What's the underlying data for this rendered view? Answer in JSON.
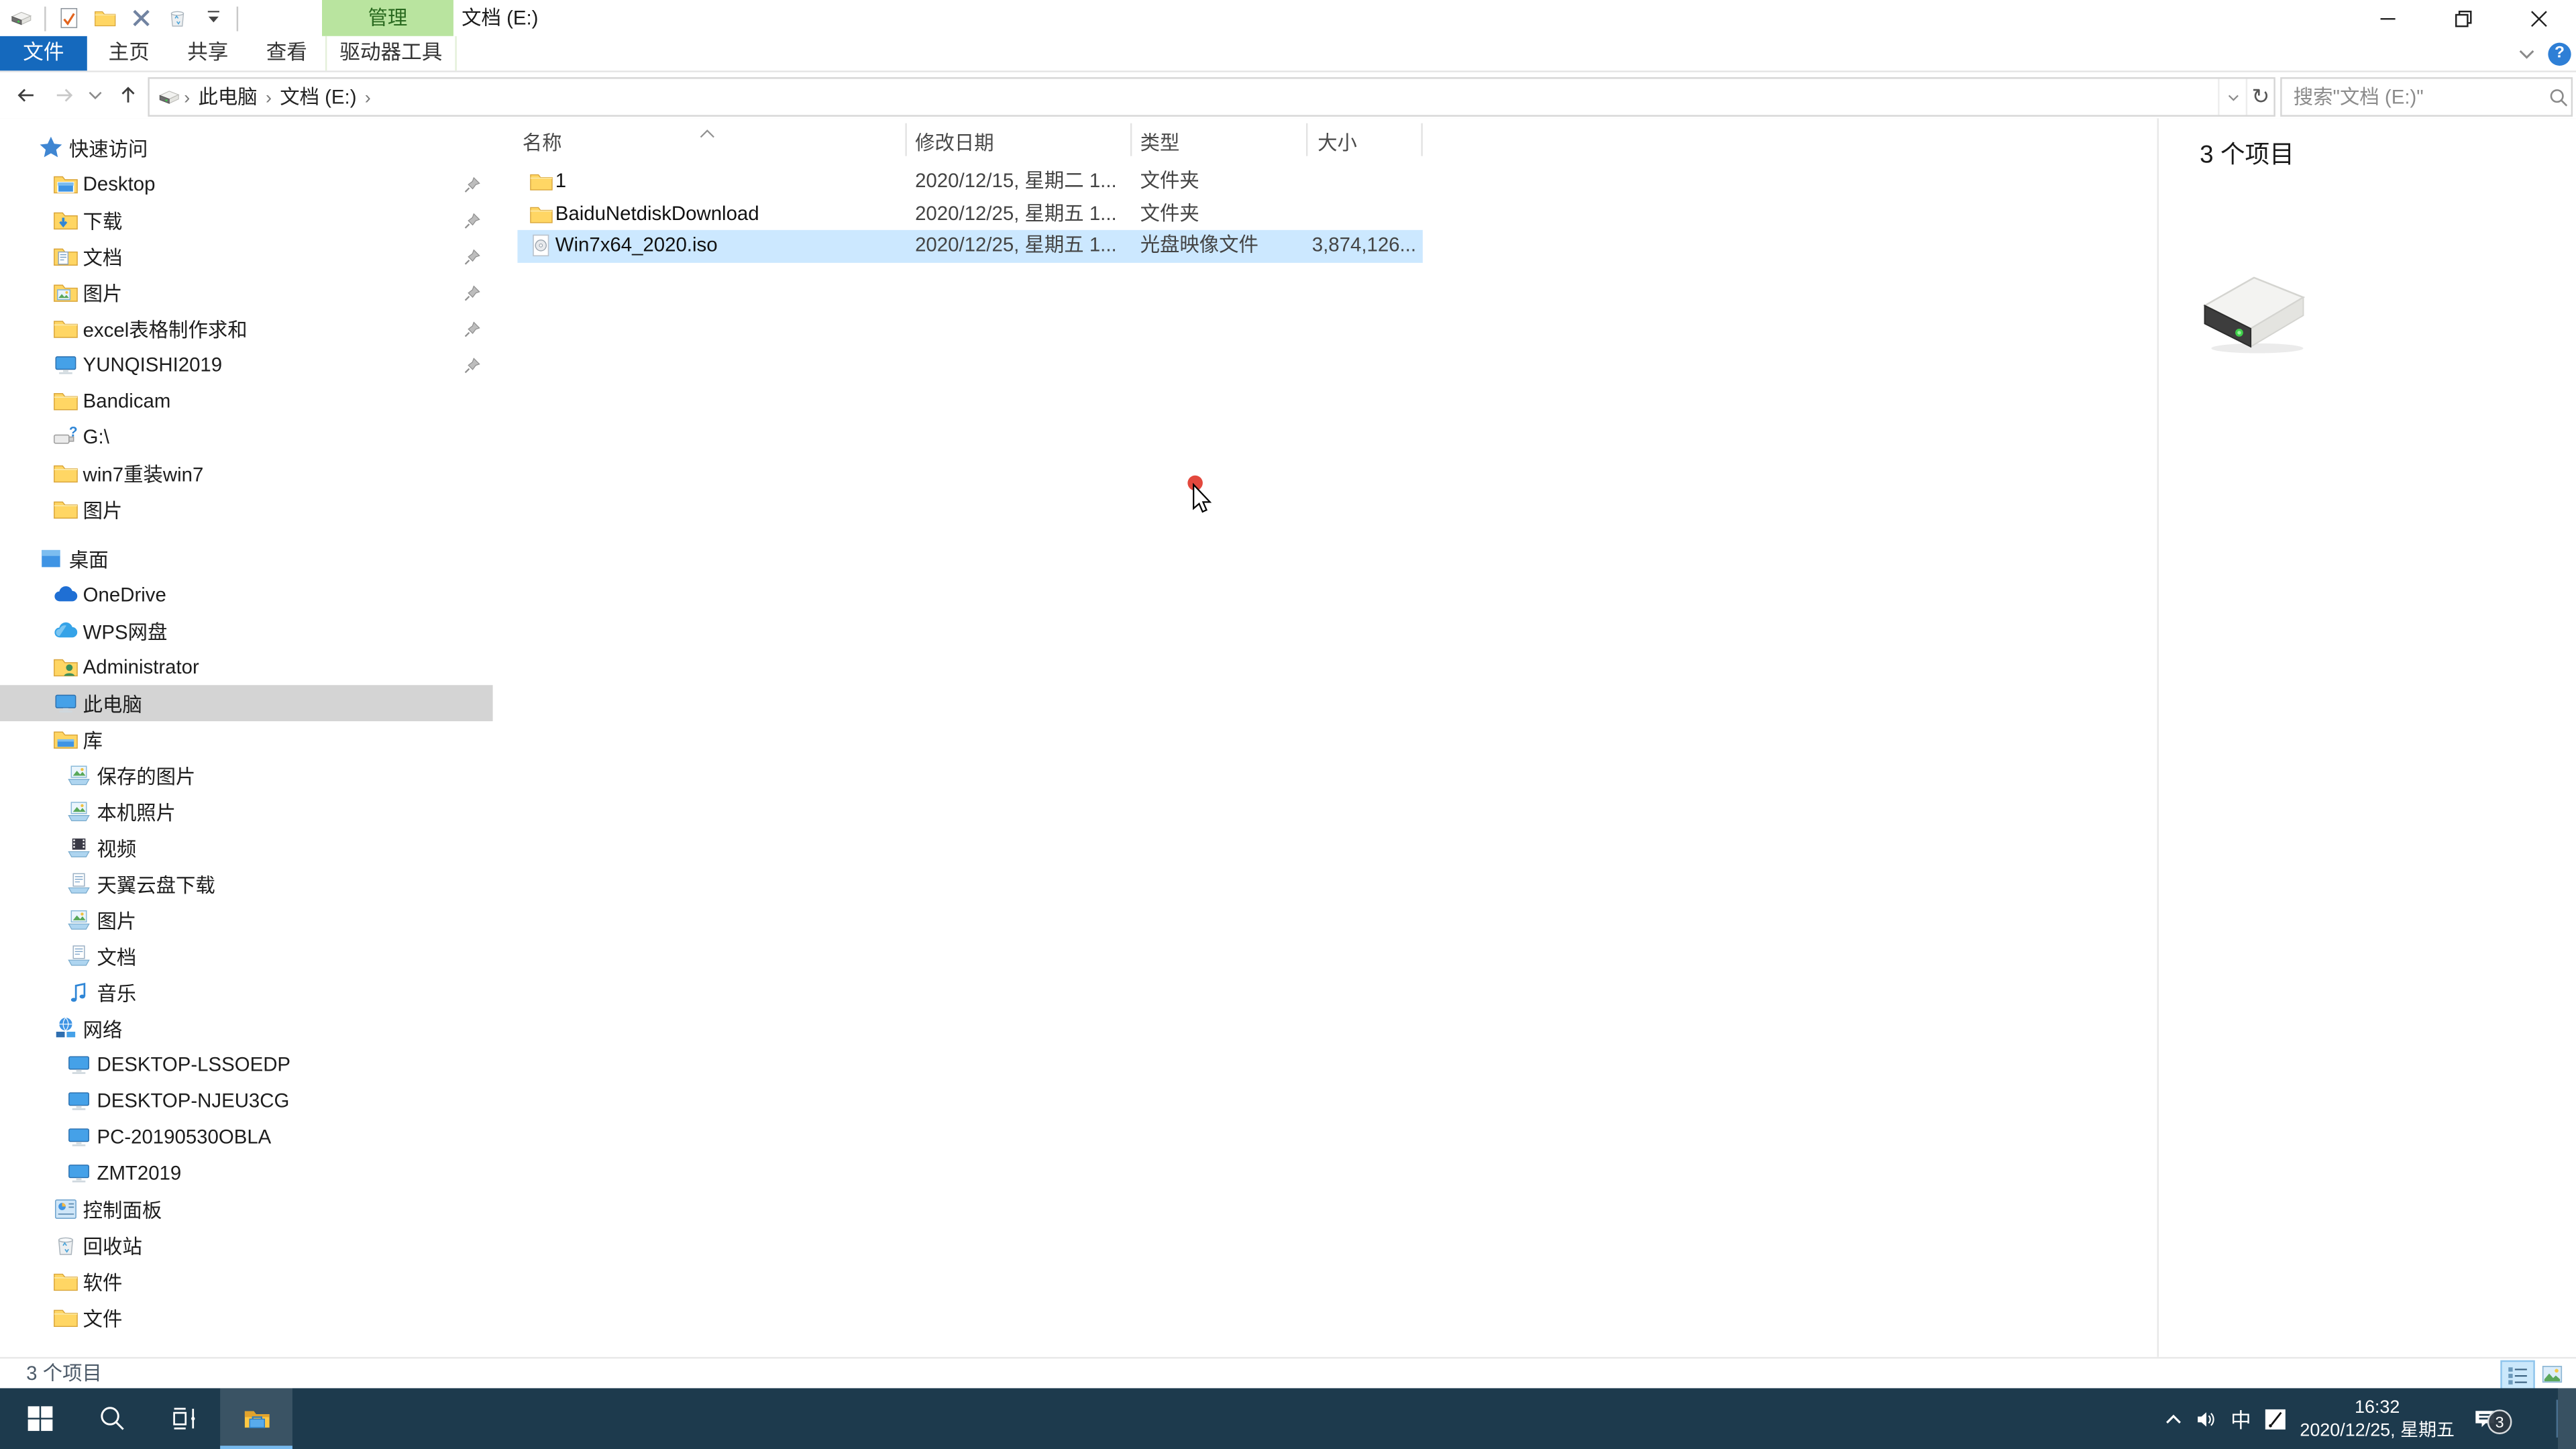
{
  "window": {
    "title": "文档 (E:)"
  },
  "qat": {
    "buttons": [
      "drive",
      "separator",
      "document-check",
      "folder",
      "delete-x",
      "recycle-bin",
      "dropdown",
      "separator"
    ]
  },
  "ribbon": {
    "contextual_group": "管理",
    "help_label": "?",
    "tabs": [
      {
        "label": "文件",
        "style": "file"
      },
      {
        "label": "主页"
      },
      {
        "label": "共享"
      },
      {
        "label": "查看"
      },
      {
        "label": "驱动器工具",
        "style": "contextual"
      }
    ]
  },
  "address": {
    "crumbs": [
      "此电脑",
      "文档 (E:)"
    ],
    "search_placeholder": "搜索\"文档 (E:)\""
  },
  "sidebar": {
    "items": [
      {
        "label": "快速访问",
        "icon": "quick-access-star",
        "level": 0
      },
      {
        "label": "Desktop",
        "icon": "folder-desktop",
        "level": 1,
        "pinned": true
      },
      {
        "label": "下载",
        "icon": "folder-download",
        "level": 1,
        "pinned": true
      },
      {
        "label": "文档",
        "icon": "folder-documents",
        "level": 1,
        "pinned": true
      },
      {
        "label": "图片",
        "icon": "folder-pictures",
        "level": 1,
        "pinned": true
      },
      {
        "label": "excel表格制作求和",
        "icon": "folder",
        "level": 1,
        "pinned": true
      },
      {
        "label": "YUNQISHI2019",
        "icon": "computer",
        "level": 1,
        "pinned": true
      },
      {
        "label": "Bandicam",
        "icon": "folder",
        "level": 1
      },
      {
        "label": "G:\\",
        "icon": "usb-drive",
        "level": 1
      },
      {
        "label": "win7重装win7",
        "icon": "folder",
        "level": 1
      },
      {
        "label": "图片",
        "icon": "folder",
        "level": 1
      },
      {
        "label": "桌面",
        "icon": "desktop",
        "level": 0,
        "section_gap": true
      },
      {
        "label": "OneDrive",
        "icon": "onedrive-cloud",
        "level": 1
      },
      {
        "label": "WPS网盘",
        "icon": "wps-cloud",
        "level": 1
      },
      {
        "label": "Administrator",
        "icon": "folder-user",
        "level": 1
      },
      {
        "label": "此电脑",
        "icon": "computer",
        "level": 1,
        "selected": true
      },
      {
        "label": "库",
        "icon": "library",
        "level": 1
      },
      {
        "label": "保存的图片",
        "icon": "library-pictures",
        "level": 2
      },
      {
        "label": "本机照片",
        "icon": "library-pictures",
        "level": 2
      },
      {
        "label": "视频",
        "icon": "library-videos",
        "level": 2
      },
      {
        "label": "天翼云盘下载",
        "icon": "library-documents",
        "level": 2
      },
      {
        "label": "图片",
        "icon": "library-pictures",
        "level": 2
      },
      {
        "label": "文档",
        "icon": "library-documents",
        "level": 2
      },
      {
        "label": "音乐",
        "icon": "music-note",
        "level": 2
      },
      {
        "label": "网络",
        "icon": "network-globe",
        "level": 1
      },
      {
        "label": "DESKTOP-LSSOEDP",
        "icon": "computer",
        "level": 2
      },
      {
        "label": "DESKTOP-NJEU3CG",
        "icon": "computer",
        "level": 2
      },
      {
        "label": "PC-20190530OBLA",
        "icon": "computer",
        "level": 2
      },
      {
        "label": "ZMT2019",
        "icon": "computer",
        "level": 2
      },
      {
        "label": "控制面板",
        "icon": "control-panel",
        "level": 1
      },
      {
        "label": "回收站",
        "icon": "recycle-bin",
        "level": 1
      },
      {
        "label": "软件",
        "icon": "folder",
        "level": 1
      },
      {
        "label": "文件",
        "icon": "folder",
        "level": 1
      }
    ]
  },
  "files": {
    "columns": [
      "名称",
      "修改日期",
      "类型",
      "大小"
    ],
    "sorted_column": "名称",
    "rows": [
      {
        "icon": "folder",
        "name": "1",
        "date": "2020/12/15, 星期二 1...",
        "type": "文件夹",
        "size": ""
      },
      {
        "icon": "folder",
        "name": "BaiduNetdiskDownload",
        "date": "2020/12/25, 星期五 1...",
        "type": "文件夹",
        "size": ""
      },
      {
        "icon": "iso-file",
        "name": "Win7x64_2020.iso",
        "date": "2020/12/25, 星期五 1...",
        "type": "光盘映像文件",
        "size": "3,874,126...",
        "selected": true
      }
    ]
  },
  "details_pane": {
    "count_text": "3 个项目",
    "icon": "drive-3d"
  },
  "status_bar": {
    "count_text": "3 个项目"
  },
  "taskbar": {
    "ime_label": "中",
    "time": "16:32",
    "date": "2020/12/25, 星期五",
    "notification_count": "3"
  },
  "colors": {
    "accent_blue": "#1569bd",
    "contextual_green": "#b9e49f",
    "selection_blue": "#cce8ff",
    "sidebar_selected": "#d4d4d4",
    "taskbar": "#1d3a4d",
    "taskbar_underline": "#76b9ed"
  }
}
